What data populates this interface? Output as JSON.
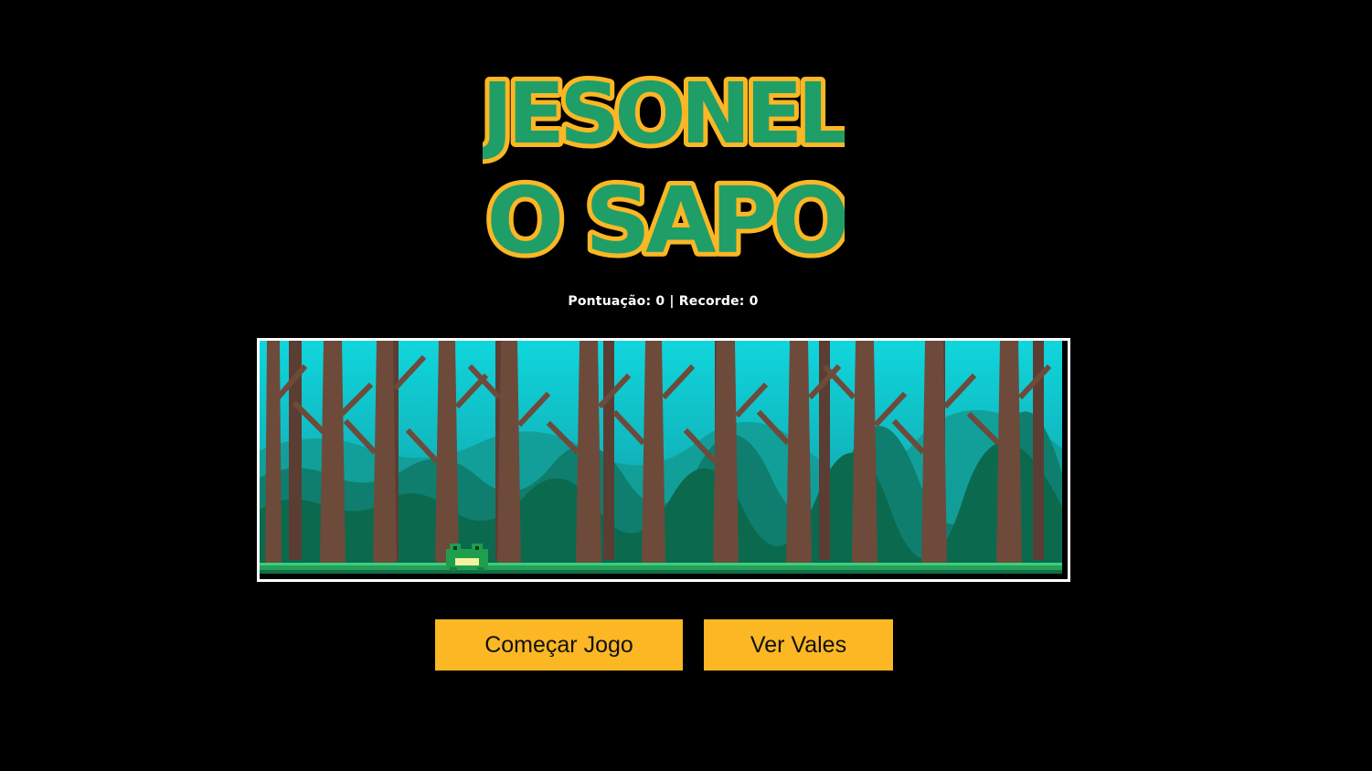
{
  "game": {
    "title_line1": "JESONEL",
    "title_line2": "O SAPO",
    "score_label": "Pontuação",
    "score_value": "0",
    "record_label": "Recorde",
    "record_value": "0"
  },
  "buttons": {
    "start_label": "Começar Jogo",
    "vales_label": "Ver Vales"
  },
  "colors": {
    "background": "#000000",
    "button": "#fbb724",
    "logo_fill": "#1f9e68",
    "logo_outline": "#fbb724",
    "sky": "#12c8c8",
    "trunk": "#6e4a3b",
    "ground": "#24a05a"
  },
  "icons": {
    "player": "frog-icon"
  }
}
